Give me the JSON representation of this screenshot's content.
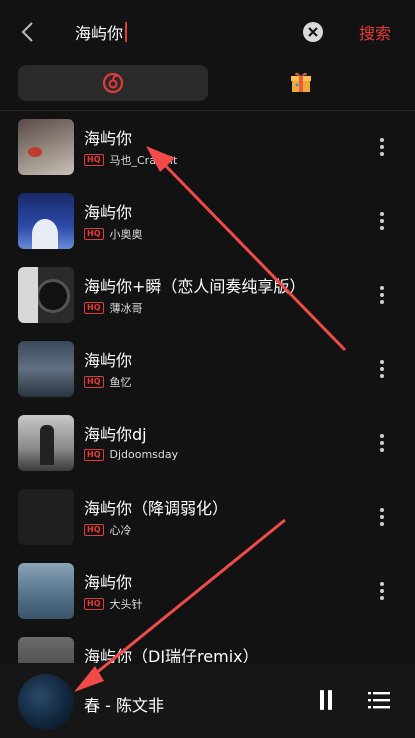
{
  "search": {
    "query": "海屿你",
    "button_label": "搜索"
  },
  "tabs": [
    {
      "icon": "netease-music-icon",
      "active": true
    },
    {
      "icon": "gift-box-icon",
      "active": false
    }
  ],
  "songs": [
    {
      "title": "海屿你",
      "quality": "HQ",
      "artist": "马也_Crabbit"
    },
    {
      "title": "海屿你",
      "quality": "HQ",
      "artist": "小奥奥"
    },
    {
      "title": "海屿你+瞬（恋人间奏纯享版）",
      "quality": "HQ",
      "artist": "薄冰哥"
    },
    {
      "title": "海屿你",
      "quality": "HQ",
      "artist": "鱼忆"
    },
    {
      "title": "海屿你dj",
      "quality": "HQ",
      "artist": "Djdoomsday"
    },
    {
      "title": "海屿你（降调弱化）",
      "quality": "HQ",
      "artist": "心冷"
    },
    {
      "title": "海屿你",
      "quality": "HQ",
      "artist": "大头针"
    },
    {
      "title": "海屿你（DJ瑞仔remix）",
      "quality": "",
      "artist": ""
    }
  ],
  "player": {
    "now_playing": "春 - 陈文非"
  },
  "colors": {
    "accent": "#e33b3b",
    "background": "#121212"
  }
}
